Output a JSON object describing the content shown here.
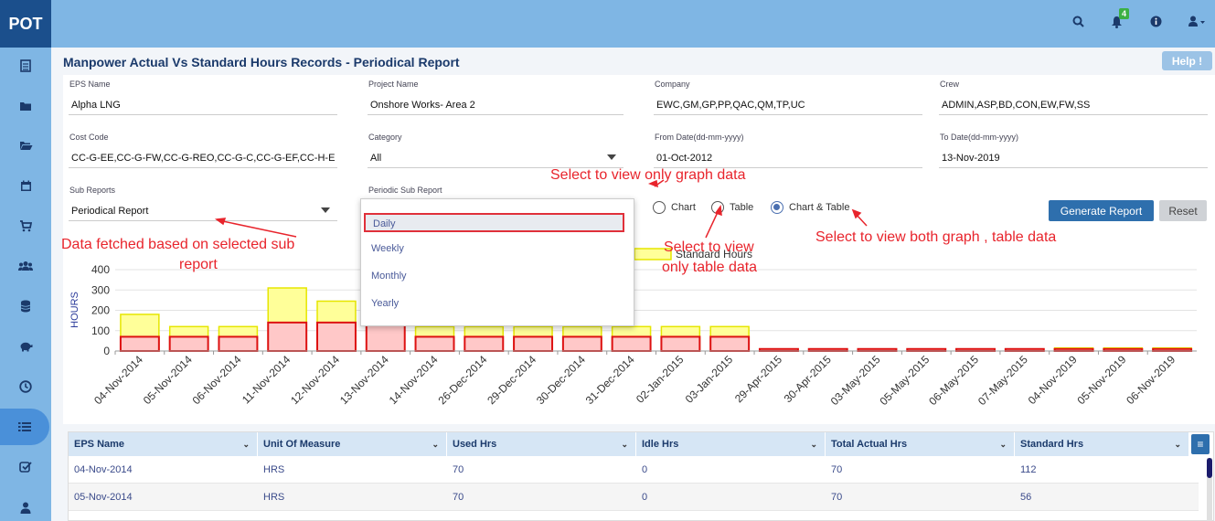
{
  "app": {
    "logo": "POT",
    "notification_count": "4"
  },
  "topbar_icons": [
    "search-icon",
    "bell-icon",
    "info-icon",
    "user-icon"
  ],
  "sidebar": {
    "items": [
      {
        "name": "report-icon"
      },
      {
        "name": "folder-icon"
      },
      {
        "name": "folder-open-icon"
      },
      {
        "name": "calendar-icon"
      },
      {
        "name": "cart-icon"
      },
      {
        "name": "users-icon"
      },
      {
        "name": "database-icon"
      },
      {
        "name": "piggy-bank-icon"
      },
      {
        "name": "clock-icon"
      },
      {
        "name": "list-icon",
        "active": true
      },
      {
        "name": "check-square-icon"
      },
      {
        "name": "user-icon"
      }
    ]
  },
  "page": {
    "title": "Manpower Actual Vs Standard Hours Records - Periodical Report",
    "help": "Help !"
  },
  "form": {
    "eps_name": {
      "label": "EPS Name",
      "value": "Alpha LNG"
    },
    "project_name": {
      "label": "Project Name",
      "value": "Onshore  Works- Area 2"
    },
    "company": {
      "label": "Company",
      "value": "EWC,GM,GP,PP,QAC,QM,TP,UC"
    },
    "crew": {
      "label": "Crew",
      "value": "ADMIN,ASP,BD,CON,EW,FW,SS"
    },
    "cost_code": {
      "label": "Cost Code",
      "value": "CC-G-EE,CC-G-FW,CC-G-REO,CC-G-C,CC-G-EF,CC-H-E"
    },
    "category": {
      "label": "Category",
      "value": "All"
    },
    "from_date": {
      "label": "From Date(dd-mm-yyyy)",
      "value": "01-Oct-2012"
    },
    "to_date": {
      "label": "To Date(dd-mm-yyyy)",
      "value": "13-Nov-2019"
    },
    "sub_reports": {
      "label": "Sub Reports",
      "value": "Periodical Report"
    },
    "periodic_sub_report": {
      "label": "Periodic Sub Report",
      "options": [
        "Daily",
        "Weekly",
        "Monthly",
        "Yearly"
      ],
      "selected": "Daily"
    },
    "view_mode": {
      "options": [
        "Chart",
        "Table",
        "Chart & Table"
      ],
      "selected": "Chart & Table"
    },
    "generate": "Generate Report",
    "reset": "Reset"
  },
  "annotations": {
    "graph": "Select to view only graph data",
    "sub_report_line1": "Data fetched based on selected sub",
    "sub_report_line2": "report",
    "table_line1": "Select to view",
    "table_line2": "only table data",
    "both": "Select to view both graph , table data"
  },
  "chart_data": {
    "type": "bar",
    "ylabel": "HOURS",
    "ylim": [
      0,
      400
    ],
    "yticks": [
      0,
      100,
      200,
      300,
      400
    ],
    "categories": [
      "04-Nov-2014",
      "05-Nov-2014",
      "06-Nov-2014",
      "11-Nov-2014",
      "12-Nov-2014",
      "13-Nov-2014",
      "14-Nov-2014",
      "26-Dec-2014",
      "29-Dec-2014",
      "30-Dec-2014",
      "31-Dec-2014",
      "02-Jan-2015",
      "03-Jan-2015",
      "29-Apr-2015",
      "30-Apr-2015",
      "03-May-2015",
      "05-May-2015",
      "06-May-2015",
      "07-May-2015",
      "04-Nov-2019",
      "05-Nov-2019",
      "06-Nov-2019"
    ],
    "series": [
      {
        "name": "Standard Hours",
        "color": "#ffff99",
        "stroke": "#e6e600",
        "values": [
          180,
          120,
          120,
          310,
          245,
          130,
          120,
          120,
          120,
          120,
          120,
          120,
          120,
          10,
          10,
          10,
          10,
          10,
          10,
          15,
          15,
          15
        ]
      },
      {
        "name": "Total Actual Hrs",
        "color": "#ffc8c8",
        "stroke": "#dd1111",
        "values": [
          70,
          70,
          70,
          140,
          140,
          140,
          70,
          70,
          70,
          70,
          70,
          70,
          70,
          10,
          10,
          10,
          10,
          10,
          10,
          10,
          10,
          10
        ]
      }
    ],
    "legend_visible": [
      "Standard Hours"
    ]
  },
  "table": {
    "columns": [
      "EPS Name",
      "Unit Of Measure",
      "Used Hrs",
      "Idle Hrs",
      "Total Actual Hrs",
      "Standard Hrs"
    ],
    "rows": [
      [
        "04-Nov-2014",
        "HRS",
        "70",
        "0",
        "70",
        "112"
      ],
      [
        "05-Nov-2014",
        "HRS",
        "70",
        "0",
        "70",
        "56"
      ]
    ]
  }
}
